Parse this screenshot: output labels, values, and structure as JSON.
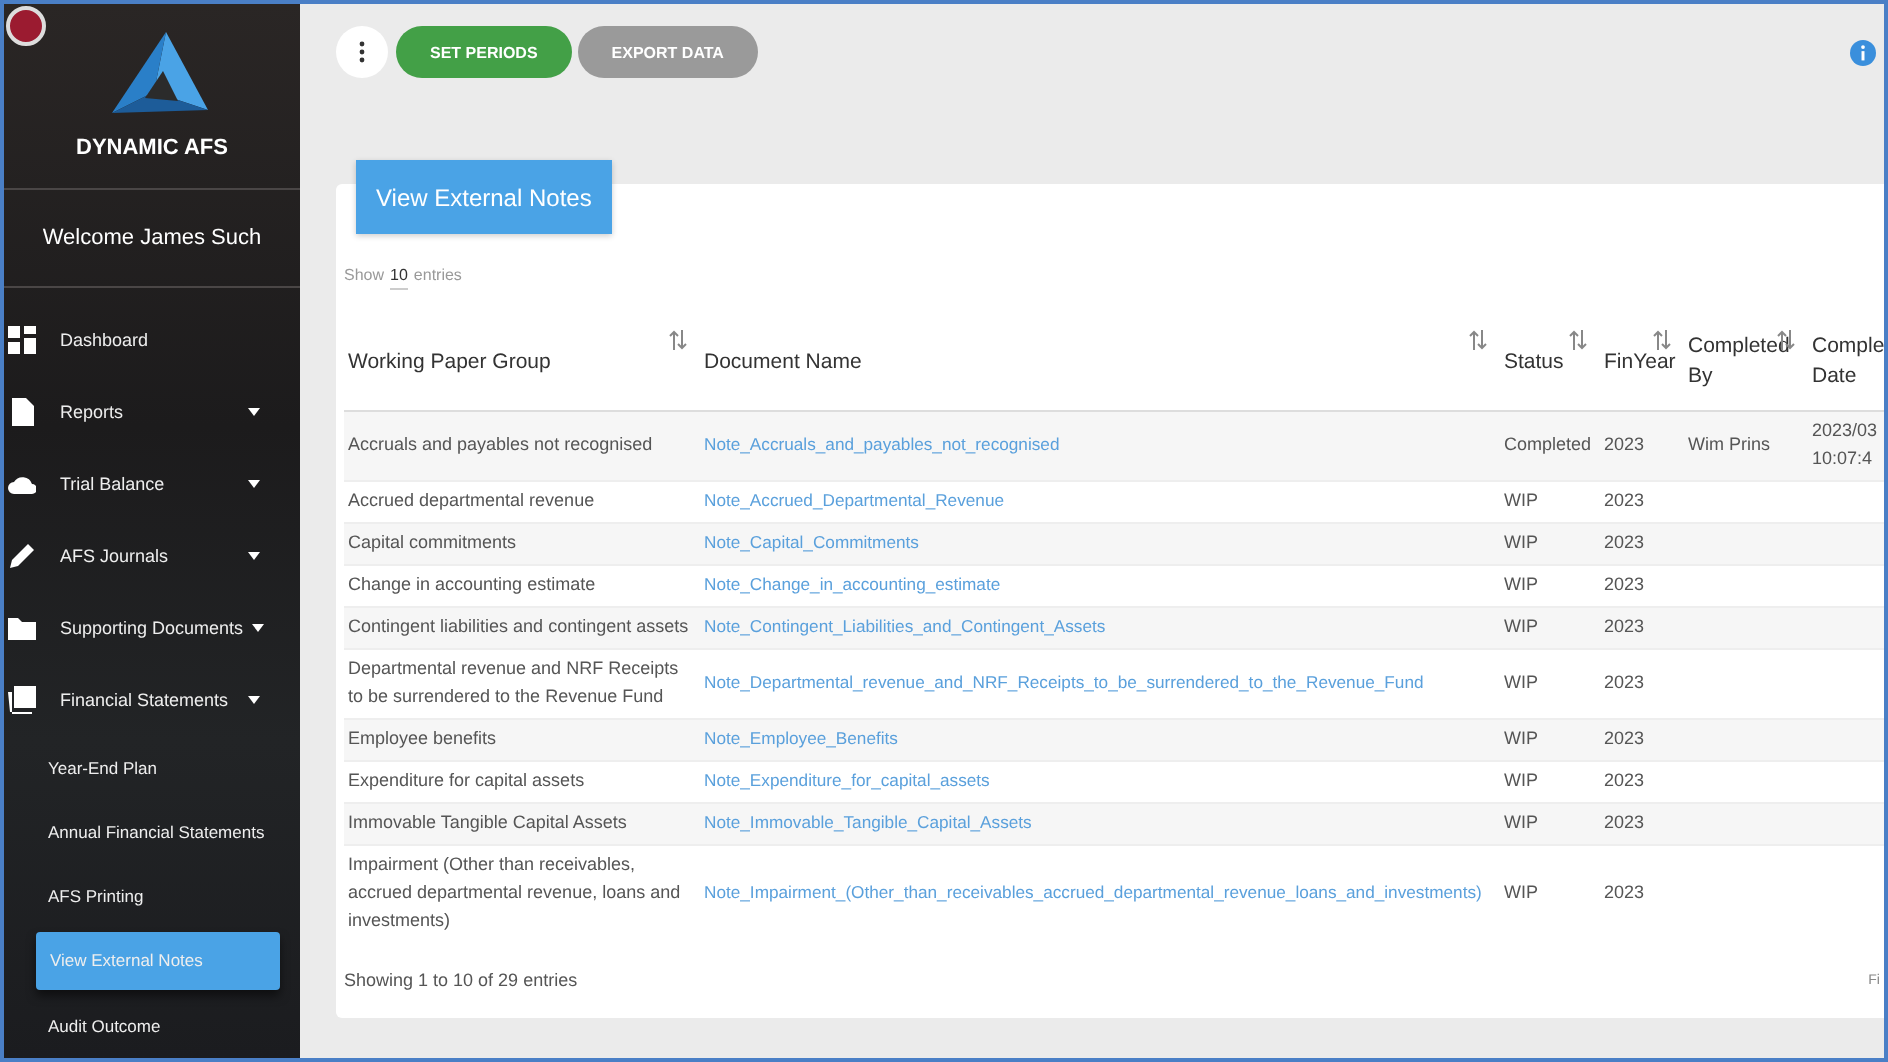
{
  "sidebar": {
    "brand": "DYNAMIC AFS",
    "welcome": "Welcome James Such",
    "items": [
      {
        "label": "Dashboard",
        "kind": "section",
        "expandable": false,
        "selected": false
      },
      {
        "label": "Reports",
        "kind": "section",
        "expandable": true,
        "selected": false
      },
      {
        "label": "Trial Balance",
        "kind": "section",
        "expandable": true,
        "selected": false
      },
      {
        "label": "AFS Journals",
        "kind": "section",
        "expandable": true,
        "selected": false
      },
      {
        "label": "Supporting Documents",
        "kind": "section",
        "expandable": true,
        "selected": false
      },
      {
        "label": "Financial Statements",
        "kind": "section",
        "expandable": true,
        "selected": false
      },
      {
        "label": "Year-End Plan",
        "kind": "sub",
        "selected": false
      },
      {
        "label": "Annual Financial Statements",
        "kind": "sub",
        "selected": false
      },
      {
        "label": "AFS Printing",
        "kind": "sub",
        "selected": false
      },
      {
        "label": "View External Notes",
        "kind": "sub",
        "selected": true
      },
      {
        "label": "Audit Outcome",
        "kind": "sub",
        "selected": false
      }
    ]
  },
  "toolbar": {
    "buttons": [
      {
        "label": "SET PERIODS",
        "kind": "primary"
      },
      {
        "label": "EXPORT DATA",
        "kind": "secondary"
      }
    ]
  },
  "card": {
    "title_button": "View External Notes",
    "length_prefix": "Show",
    "length_value": "10",
    "length_suffix": "entries",
    "table": {
      "columns": [
        {
          "label": "Working Paper Group",
          "sortable": true
        },
        {
          "label": "Document Name",
          "sortable": true
        },
        {
          "label": "Status",
          "sortable": true
        },
        {
          "label": "FinYear",
          "sortable": true
        },
        {
          "label": "Completed\nBy",
          "sortable": true
        },
        {
          "label": "Comple\nDate",
          "sortable": false
        }
      ],
      "rows": [
        [
          "Accruals and payables not recognised",
          "Note_Accruals_and_payables_not_recognised",
          "Completed",
          "2023",
          "Wim Prins",
          "2023/03\n10:07:4"
        ],
        [
          "Accrued departmental revenue",
          "Note_Accrued_Departmental_Revenue",
          "WIP",
          "2023",
          "",
          ""
        ],
        [
          "Capital commitments",
          "Note_Capital_Commitments",
          "WIP",
          "2023",
          "",
          ""
        ],
        [
          "Change in accounting estimate",
          "Note_Change_in_accounting_estimate",
          "WIP",
          "2023",
          "",
          ""
        ],
        [
          "Contingent liabilities and contingent assets",
          "Note_Contingent_Liabilities_and_Contingent_Assets",
          "WIP",
          "2023",
          "",
          ""
        ],
        [
          "Departmental revenue and NRF Receipts to be surrendered to the Revenue Fund",
          "Note_Departmental_revenue_and_NRF_Receipts_to_be_surrendered_to_the_Revenue_Fund",
          "WIP",
          "2023",
          "",
          ""
        ],
        [
          "Employee benefits",
          "Note_Employee_Benefits",
          "WIP",
          "2023",
          "",
          ""
        ],
        [
          "Expenditure for capital assets",
          "Note_Expenditure_for_capital_assets",
          "WIP",
          "2023",
          "",
          ""
        ],
        [
          "Immovable Tangible Capital Assets",
          "Note_Immovable_Tangible_Capital_Assets",
          "WIP",
          "2023",
          "",
          ""
        ],
        [
          "Impairment (Other than receivables, accrued departmental revenue, loans and investments)",
          "Note_Impairment_(Other_than_receivables_accrued_departmental_revenue_loans_and_investments)",
          "WIP",
          "2023",
          "",
          ""
        ]
      ]
    },
    "info": "Showing 1 to 10 of 29 entries",
    "paging": "Fi"
  }
}
